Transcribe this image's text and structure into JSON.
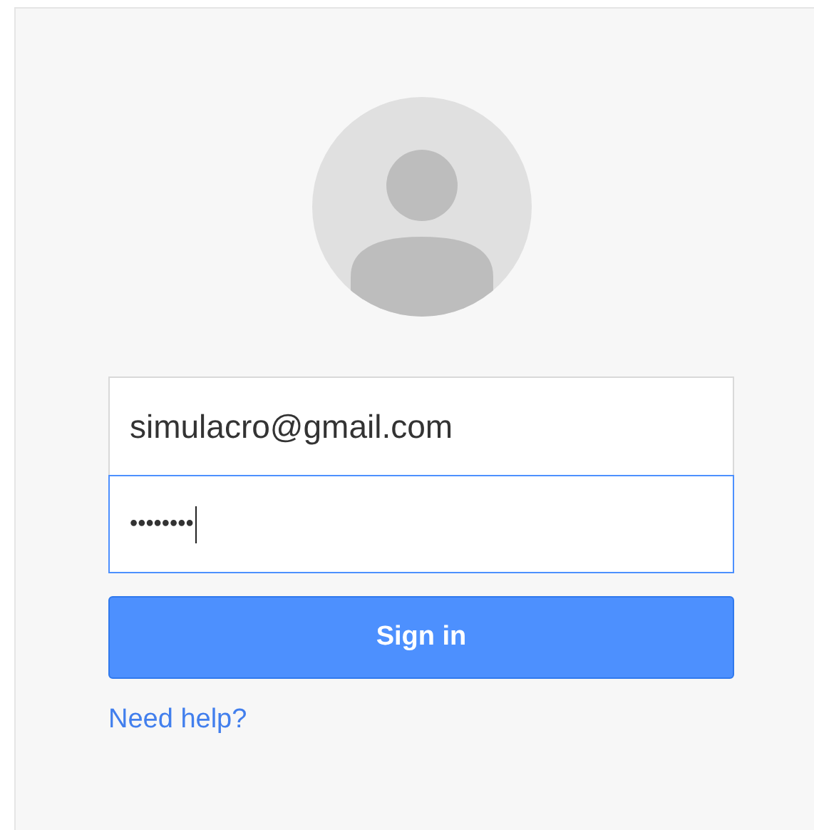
{
  "account": {
    "email": "simulacro@gmail.com",
    "password": "••••••••",
    "password_focused": true
  },
  "sign_in_button": {
    "label": "Sign in"
  },
  "help_link": {
    "label": "Need help?"
  }
}
